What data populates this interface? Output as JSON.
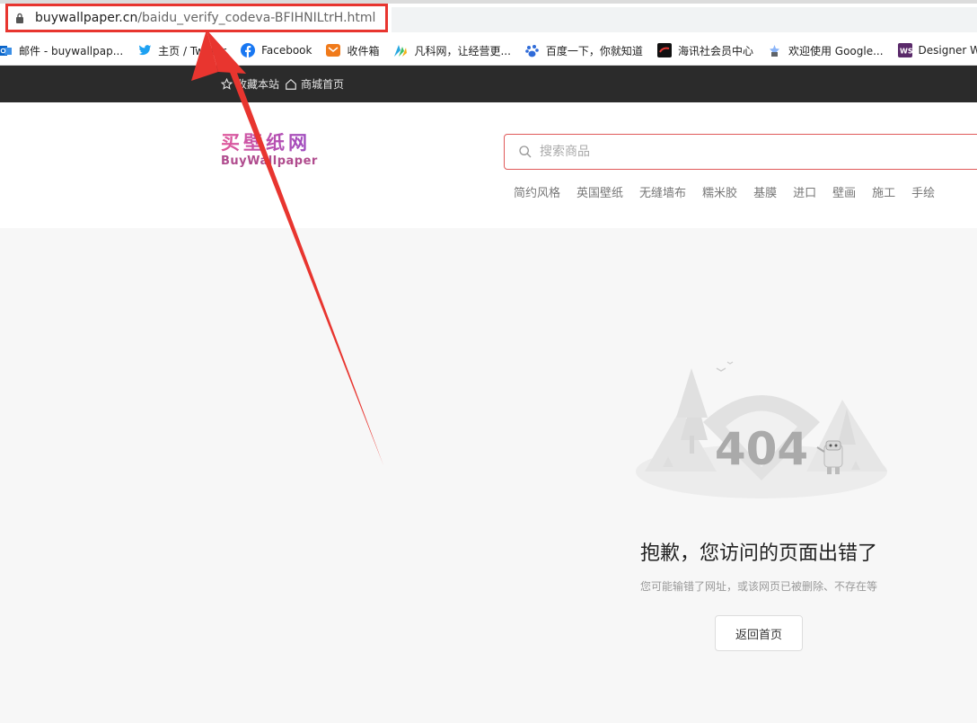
{
  "browser": {
    "url_host": "buywallpaper.cn",
    "url_path": "/baidu_verify_codeva-BFIHNILtrH.html",
    "bookmarks": [
      {
        "label": "邮件 - buywallpap...",
        "icon": "outlook-icon",
        "color": "#0a64c8"
      },
      {
        "label": "主页 / Twitter",
        "icon": "twitter-icon",
        "color": "#1da1f2"
      },
      {
        "label": "Facebook",
        "icon": "facebook-icon",
        "color": "#1877f2"
      },
      {
        "label": "收件箱",
        "icon": "mail-icon",
        "color": "#f07a1a"
      },
      {
        "label": "凡科网，让经营更...",
        "icon": "fanke-icon",
        "color": "#28a8e0"
      },
      {
        "label": "百度一下，你就知道",
        "icon": "baidu-icon",
        "color": "#2f6bd8"
      },
      {
        "label": "海讯社会员中心",
        "icon": "haixun-icon",
        "color": "#111111"
      },
      {
        "label": "欢迎使用 Google...",
        "icon": "google-icon",
        "color": "#5f6368"
      },
      {
        "label": "Designer W",
        "icon": "designer-icon",
        "color": "#5a2a6a"
      }
    ]
  },
  "site": {
    "topbar": {
      "favorite": "收藏本站",
      "home": "商城首页"
    },
    "logo": {
      "cn": "买壁纸网",
      "en": "BuyWallpaper"
    },
    "search": {
      "placeholder": "搜索商品"
    },
    "categories": [
      "简约风格",
      "英国壁纸",
      "无缝墙布",
      "糯米胶",
      "基膜",
      "进口",
      "壁画",
      "施工",
      "手绘"
    ]
  },
  "error": {
    "code": "404",
    "title": "抱歉，您访问的页面出错了",
    "subtitle": "您可能输错了网址，或该网页已被删除、不存在等",
    "button": "返回首页"
  },
  "colors": {
    "highlight": "#e8352f",
    "topbar": "#2b2b2b",
    "search_border": "#e05a5a"
  }
}
